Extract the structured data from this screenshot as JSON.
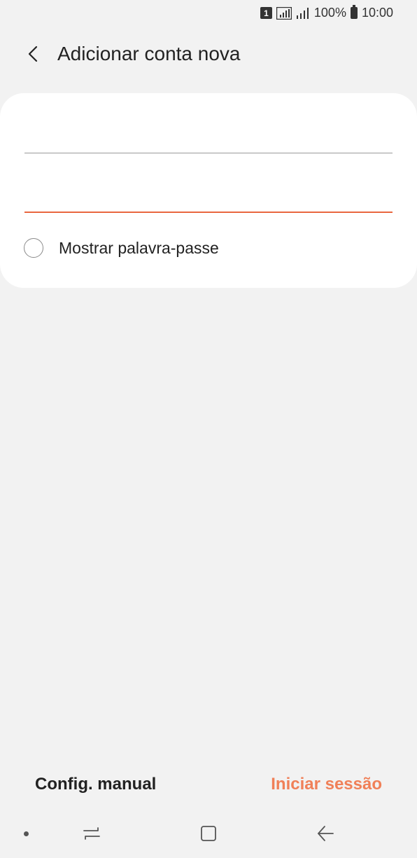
{
  "status_bar": {
    "sim_slot": "1",
    "battery": "100%",
    "time": "10:00"
  },
  "header": {
    "title": "Adicionar conta nova",
    "back_icon": "chevron-left-icon"
  },
  "form": {
    "email_value": "",
    "email_placeholder": "",
    "password_value": "",
    "password_placeholder": "",
    "show_password_label": "Mostrar palavra-passe",
    "show_password_checked": false,
    "accent_color": "#e9673f"
  },
  "actions": {
    "manual_label": "Config. manual",
    "signin_label": "Iniciar sessão",
    "signin_color": "#f08058"
  },
  "nav": {
    "recents_icon": "recents-icon",
    "home_icon": "home-icon",
    "back_icon": "back-arrow-icon"
  }
}
